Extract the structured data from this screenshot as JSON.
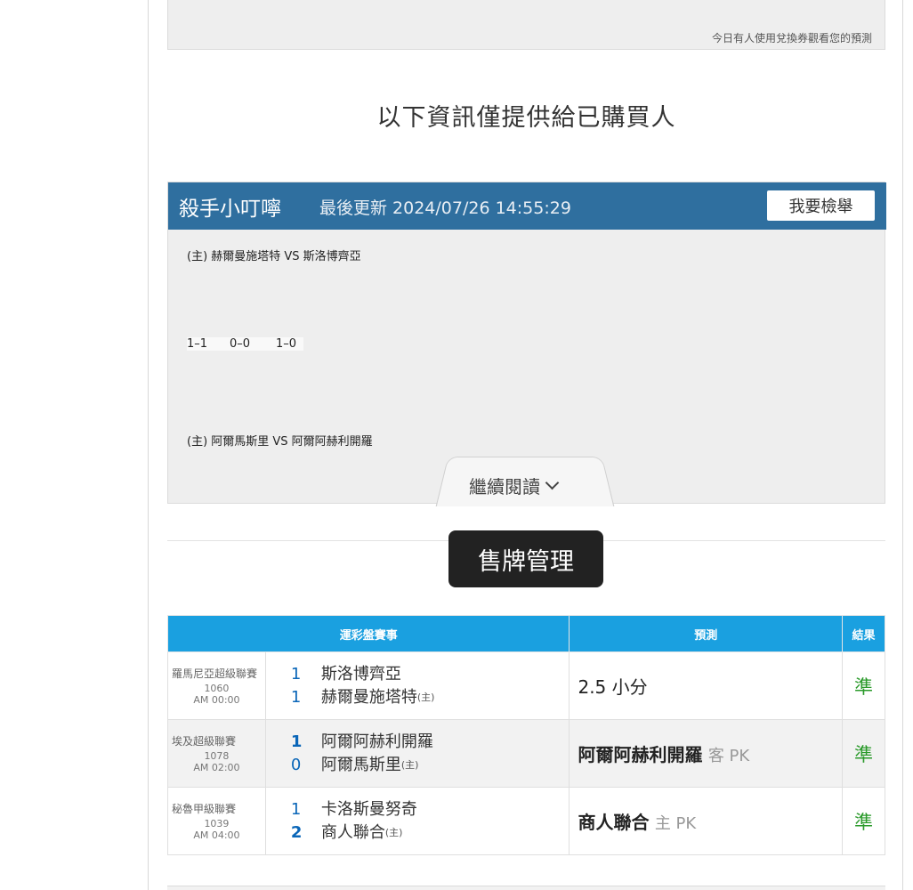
{
  "top_note": "今日有人使用兌換券觀看您的預測",
  "buyers_heading": "以下資訊僅提供給已購買人",
  "prediction": {
    "author": "殺手小叮嚀",
    "updated": "最後更新 2024/07/26 14:55:29",
    "report_label": "我要檢舉",
    "match1": "(主) 赫爾曼施塔特 VS 斯洛博齊亞",
    "scores": [
      "1–1",
      "0–0",
      "1–0"
    ],
    "match2": "(主) 阿爾馬斯里 VS 阿爾阿赫利開羅",
    "read_more_label": "繼續閱讀"
  },
  "sales_label": "售牌管理",
  "table": {
    "headers": [
      "運彩盤賽事",
      "預測",
      "結果"
    ],
    "home_mark": "(主)",
    "rows": [
      {
        "league": "羅馬尼亞超級聯賽",
        "code": "1060",
        "time": "AM 00:00",
        "away_score": "1",
        "away_team": "斯洛博齊亞",
        "home_score": "1",
        "home_team": "赫爾曼施塔特",
        "pick_main": "2.5 小分",
        "pick_sub": "",
        "result": "準"
      },
      {
        "league": "埃及超級聯賽",
        "code": "1078",
        "time": "AM 02:00",
        "away_score": "1",
        "away_team": "阿爾阿赫利開羅",
        "home_score": "0",
        "home_team": "阿爾馬斯里",
        "pick_main": "阿爾阿赫利開羅",
        "pick_sub": "客 PK",
        "result": "準"
      },
      {
        "league": "秘魯甲級聯賽",
        "code": "1039",
        "time": "AM 04:00",
        "away_score": "1",
        "away_team": "卡洛斯曼努奇",
        "home_score": "2",
        "home_team": "商人聯合",
        "pick_main": "商人聯合",
        "pick_sub": "主 PK",
        "result": "準"
      }
    ]
  },
  "colors": {
    "header_blue": "#2f6f9f",
    "table_header": "#1aa0e0",
    "result_green": "#2a9a2a",
    "score_blue": "#0a66b8"
  }
}
